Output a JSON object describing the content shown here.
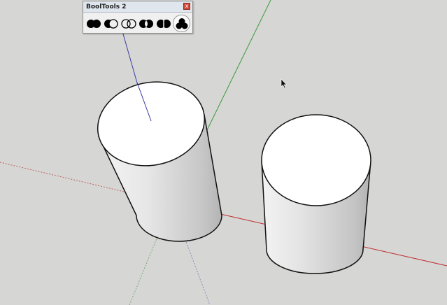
{
  "toolbar": {
    "title": "BoolTools 2",
    "close_label": "x",
    "tools": [
      {
        "icon": "union-icon"
      },
      {
        "icon": "subtract-icon"
      },
      {
        "icon": "intersect-icon"
      },
      {
        "icon": "trim-icon"
      },
      {
        "icon": "split-icon"
      },
      {
        "icon": "multi-union-icon",
        "active": true
      }
    ]
  },
  "scene": {
    "background": "#d6d6d4",
    "axis_colors": {
      "red": "#c03030",
      "green": "#3a9a3a",
      "blue": "#3a3aa6"
    },
    "objects": [
      "cylinder",
      "cylinder"
    ]
  }
}
